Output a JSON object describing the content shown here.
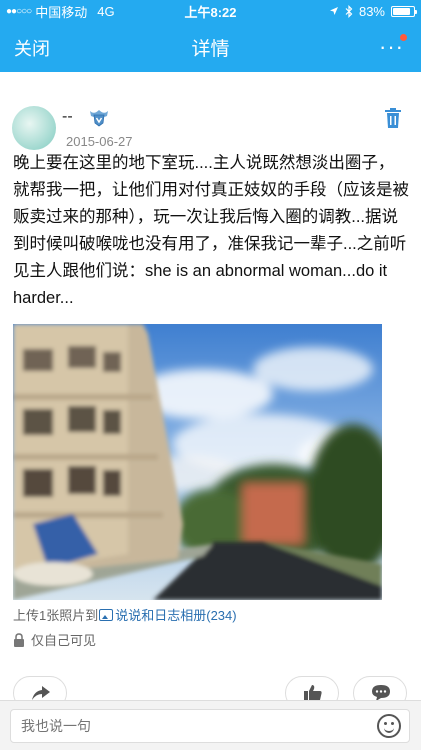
{
  "status_bar": {
    "carrier": "中国移动",
    "network": "4G",
    "time": "上午8:22",
    "battery": "83%",
    "battery_level": 0.83
  },
  "nav": {
    "close_label": "关闭",
    "title": "详情"
  },
  "post": {
    "author": "--",
    "date": "2015-06-27",
    "text": "晚上要在这里的地下室玩....主人说既然想淡出圈子，就帮我一把，让他们用对付真正妓奴的手段（应该是被贩卖过来的那种），玩一次让我后悔入圈的调教...据说到时候叫破喉咙也没有用了，准保我记一辈子...之前听见主人跟他们说：she is an abnormal woman...do it harder...",
    "upload_prefix": "上传1张照片到",
    "album_link": "说说和日志相册(234)",
    "privacy": "仅自己可见"
  },
  "comment": {
    "placeholder": "我也说一句"
  },
  "icons": {
    "nav_more": "more-dots-icon",
    "delete": "trash-icon",
    "share": "share-arrow-icon",
    "like": "thumbs-up-icon",
    "comment": "comment-bubble-icon",
    "emoji": "emoji-icon",
    "lock": "lock-icon",
    "album": "album-icon"
  },
  "colors": {
    "nav_bg": "#24aaf0",
    "link": "#2a6fb0",
    "notify_dot": "#ff5a3c"
  }
}
